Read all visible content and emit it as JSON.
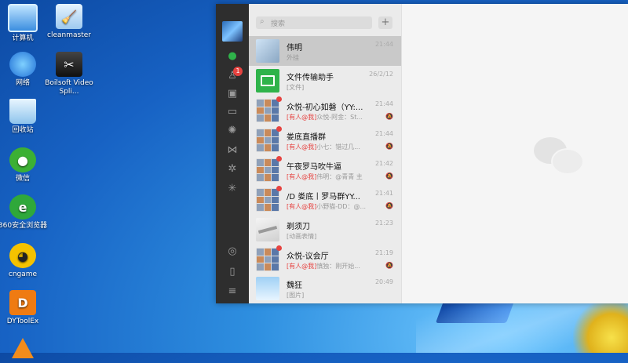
{
  "desktop": {
    "icons": [
      {
        "label": "计算机",
        "icon": "computer-icon"
      },
      {
        "label": "cleanmaster",
        "icon": "cleanmaster-icon"
      },
      {
        "label": "网络",
        "icon": "network-icon"
      },
      {
        "label": "Boilsoft Video Spli...",
        "icon": "boilsoft-icon"
      },
      {
        "label": "回收站",
        "icon": "recycle-bin-icon"
      },
      {
        "label": "微信",
        "icon": "wechat-icon"
      },
      {
        "label": "360安全浏览器",
        "icon": "360-browser-icon"
      },
      {
        "label": "cngame",
        "icon": "cngame-icon"
      },
      {
        "label": "DYToolEx",
        "icon": "dytoolex-icon"
      }
    ]
  },
  "wechat": {
    "nav": {
      "badge": "1"
    },
    "search": {
      "placeholder": "搜索",
      "plus": "+"
    },
    "chats": [
      {
        "name": "伟明",
        "time": "21:44",
        "preview": "外挂",
        "at": "",
        "dot": false,
        "muted": false,
        "avatar": "person"
      },
      {
        "name": "文件传输助手",
        "time": "26/2/12",
        "preview": "[文件]",
        "at": "",
        "dot": false,
        "muted": false,
        "avatar": "file"
      },
      {
        "name": "众悦-初心如磐（YY:...",
        "time": "21:44",
        "preview": "众悦-阿金：St...",
        "at": "[有人@我]",
        "dot": true,
        "muted": true,
        "avatar": "group"
      },
      {
        "name": "娄底直播群",
        "time": "21:44",
        "preview": "小七：错过几...",
        "at": "[有人@我]",
        "dot": true,
        "muted": true,
        "avatar": "group"
      },
      {
        "name": "午夜罗马吹牛逼",
        "time": "21:42",
        "preview": "伟明：@青青 主",
        "at": "[有人@我]",
        "dot": true,
        "muted": true,
        "avatar": "group"
      },
      {
        "name": "/D 娄底丨罗马群YY...",
        "time": "21:41",
        "preview": "小野猫-DD：@...",
        "at": "[有人@我]",
        "dot": true,
        "muted": true,
        "avatar": "group"
      },
      {
        "name": "剃须刀",
        "time": "21:23",
        "preview": "[动画表情]",
        "at": "",
        "dot": false,
        "muted": false,
        "avatar": "knife"
      },
      {
        "name": "众悦-议会厅",
        "time": "21:19",
        "preview": "慎独：刚开始...",
        "at": "[有人@我]",
        "dot": true,
        "muted": true,
        "avatar": "group"
      },
      {
        "name": "魏狂",
        "time": "20:49",
        "preview": "[图片]",
        "at": "",
        "dot": false,
        "muted": false,
        "avatar": "person2"
      }
    ]
  }
}
